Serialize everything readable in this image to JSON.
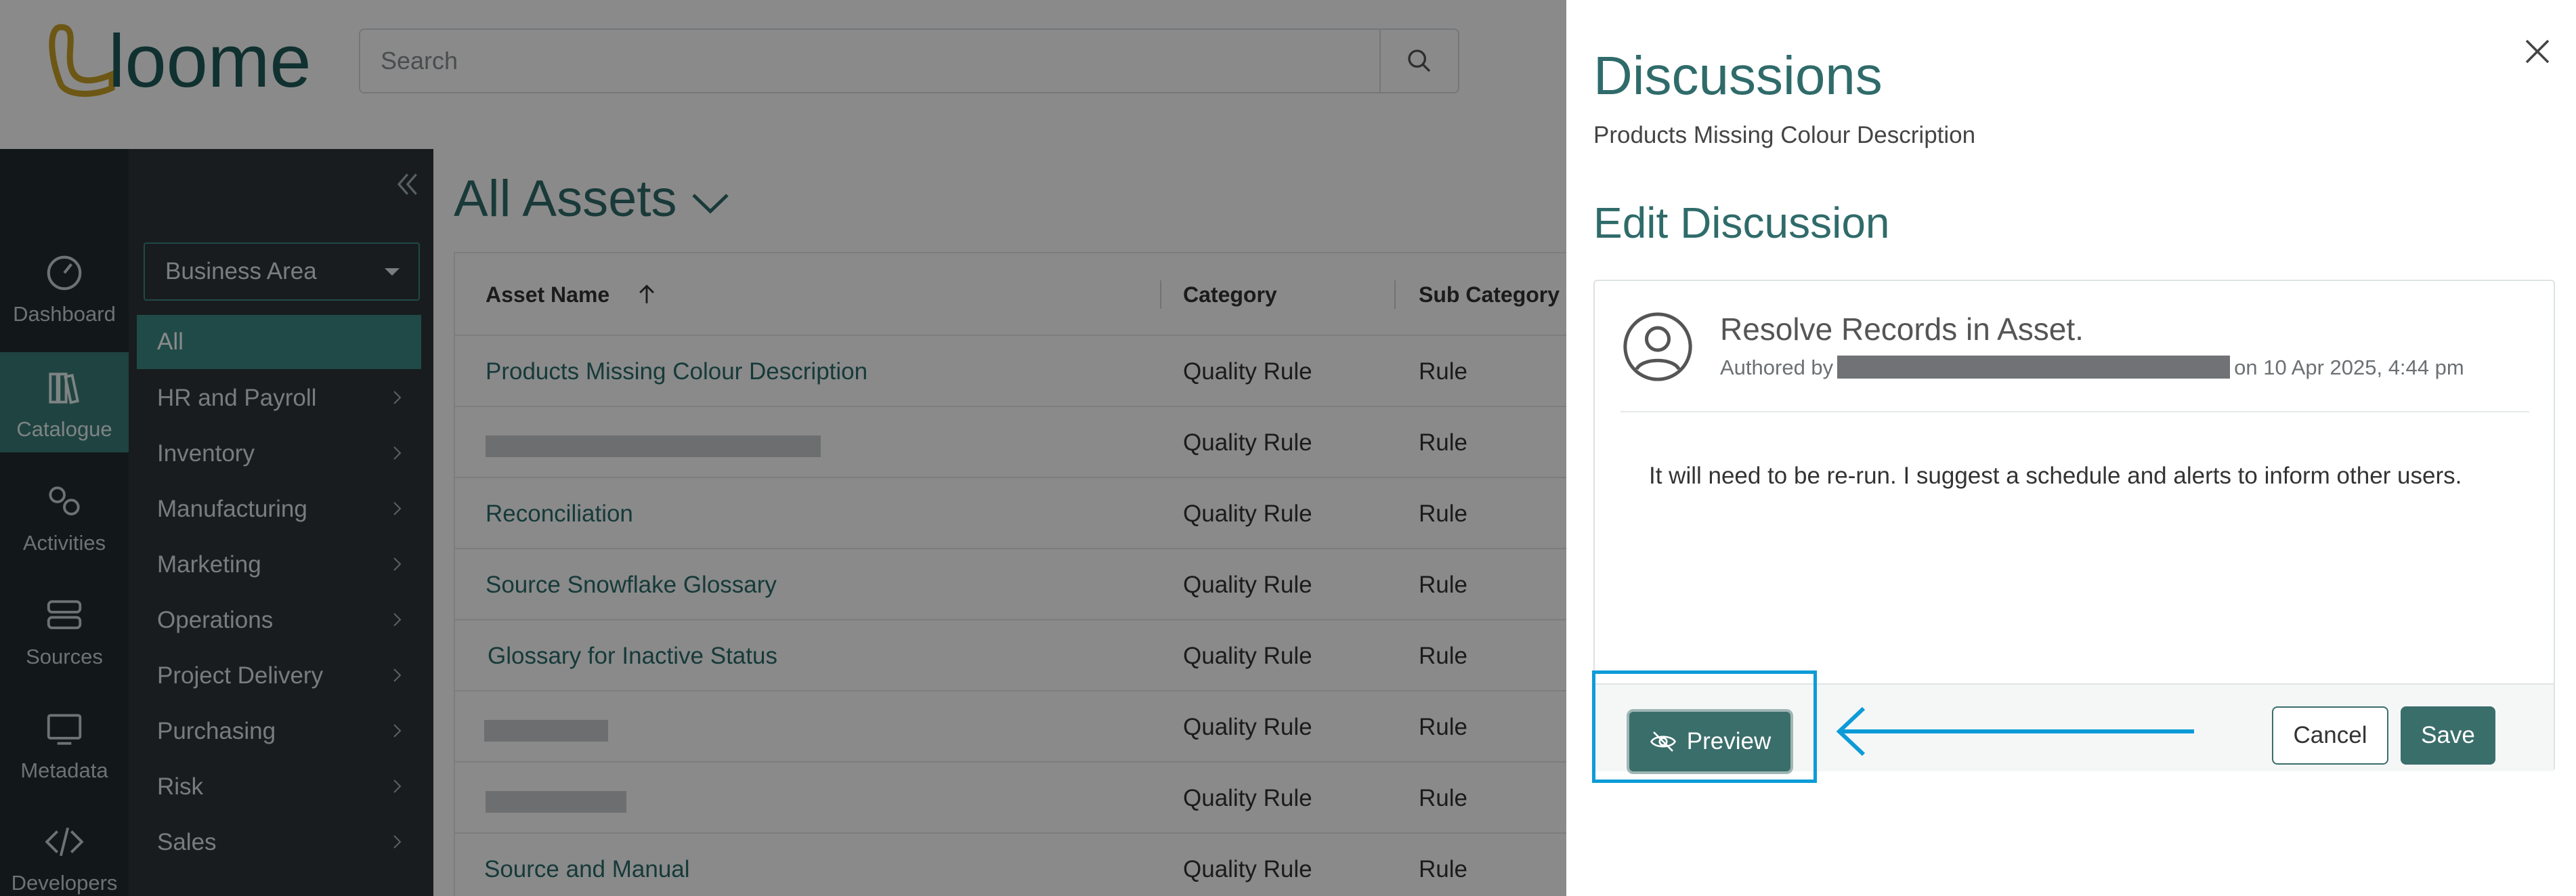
{
  "app": {
    "logo_text": "loome"
  },
  "search": {
    "placeholder": "Search"
  },
  "rail": {
    "items": [
      {
        "label": "Dashboard",
        "icon": "dashboard-icon"
      },
      {
        "label": "Catalogue",
        "icon": "catalogue-icon",
        "active": true
      },
      {
        "label": "Activities",
        "icon": "activities-icon"
      },
      {
        "label": "Sources",
        "icon": "sources-icon"
      },
      {
        "label": "Metadata",
        "icon": "metadata-icon"
      },
      {
        "label": "Developers",
        "icon": "developers-icon"
      }
    ]
  },
  "sidenav": {
    "filter_value": "Business Area",
    "items": [
      {
        "label": "All",
        "active": true
      },
      {
        "label": "HR and Payroll"
      },
      {
        "label": "Inventory"
      },
      {
        "label": "Manufacturing"
      },
      {
        "label": "Marketing"
      },
      {
        "label": "Operations"
      },
      {
        "label": "Project Delivery"
      },
      {
        "label": "Purchasing"
      },
      {
        "label": "Risk"
      },
      {
        "label": "Sales"
      }
    ]
  },
  "main": {
    "title": "All Assets",
    "columns": [
      "Asset Name",
      "Category",
      "Sub Category"
    ],
    "rows": [
      {
        "name": "Products Missing Colour Description",
        "category": "Quality Rule",
        "sub": "Rule"
      },
      {
        "name": "",
        "category": "Quality Rule",
        "sub": "Rule"
      },
      {
        "name": "Reconciliation",
        "category": "Quality Rule",
        "sub": "Rule"
      },
      {
        "name": "Source Snowflake Glossary",
        "category": "Quality Rule",
        "sub": "Rule"
      },
      {
        "name": "Glossary for Inactive Status",
        "category": "Quality Rule",
        "sub": "Rule"
      },
      {
        "name": "",
        "category": "Quality Rule",
        "sub": "Rule"
      },
      {
        "name": "",
        "category": "Quality Rule",
        "sub": "Rule"
      },
      {
        "name": "Source and Manual",
        "category": "Quality Rule",
        "sub": "Rule"
      }
    ]
  },
  "panel": {
    "title": "Discussions",
    "subtitle": "Products Missing Colour Description",
    "section_title": "Edit Discussion",
    "discussion": {
      "title": "Resolve Records in Asset.",
      "authored_prefix": "Authored by",
      "date_text": "on 10 Apr 2025, 4:44 pm",
      "body": "It will need to be re-run. I suggest a schedule and alerts to inform other users."
    },
    "buttons": {
      "preview": "Preview",
      "cancel": "Cancel",
      "save": "Save"
    }
  },
  "colors": {
    "accent": "#3a6e6b",
    "highlight": "#0d9bd8",
    "nav_bg": "#2d3438",
    "rail_bg": "#222b30"
  }
}
